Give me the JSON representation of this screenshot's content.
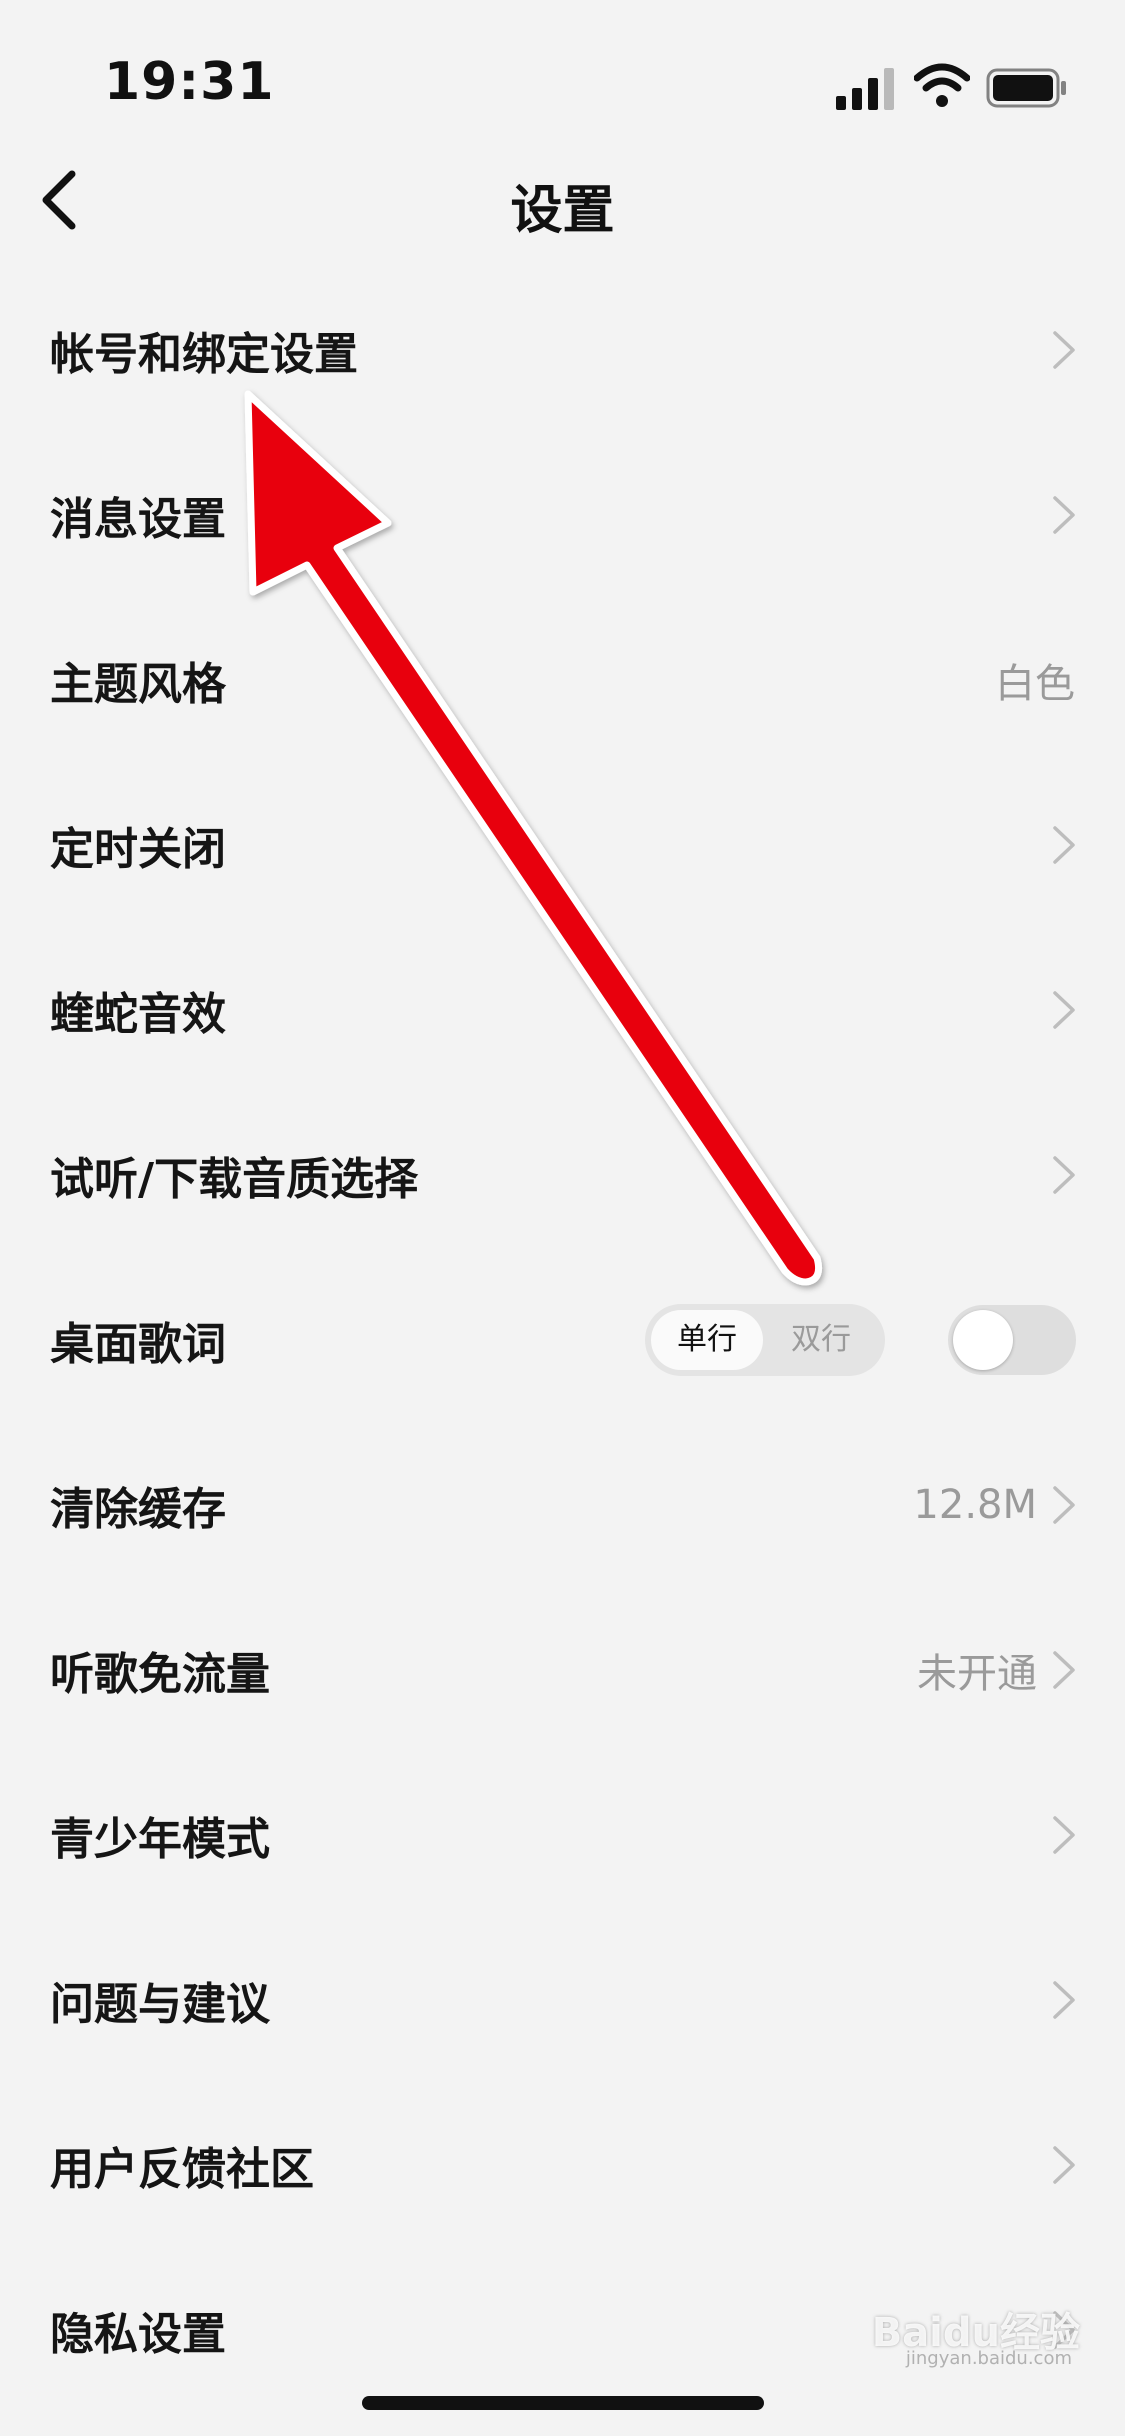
{
  "status_bar": {
    "time": "19:31",
    "icons": [
      "signal-icon",
      "wifi-icon",
      "battery-icon"
    ]
  },
  "nav": {
    "title": "设置",
    "back_icon": "chevron-left-icon"
  },
  "settings": [
    {
      "label": "帐号和绑定设置",
      "value": "",
      "chevron": true
    },
    {
      "label": "消息设置",
      "value": "",
      "chevron": true
    },
    {
      "label": "主题风格",
      "value": "白色",
      "chevron": false
    },
    {
      "label": "定时关闭",
      "value": "",
      "chevron": true
    },
    {
      "label": "蝰蛇音效",
      "value": "",
      "chevron": true
    },
    {
      "label": "试听/下载音质选择",
      "value": "",
      "chevron": true
    },
    {
      "label": "桌面歌词",
      "segments": [
        "单行",
        "双行"
      ],
      "selected_segment": "单行",
      "toggle_on": false
    },
    {
      "label": "清除缓存",
      "value": "12.8M",
      "chevron": true
    },
    {
      "label": "听歌免流量",
      "value": "未开通",
      "chevron": true
    },
    {
      "label": "青少年模式",
      "value": "",
      "chevron": true
    },
    {
      "label": "问题与建议",
      "value": "",
      "chevron": true
    },
    {
      "label": "用户反馈社区",
      "value": "",
      "chevron": true
    },
    {
      "label": "隐私设置",
      "value": "",
      "chevron": true
    }
  ],
  "annotation": {
    "color": "#e8000b",
    "outline": "#ffffff"
  },
  "watermark": {
    "text": "Baidu经验",
    "sub": "jingyan.baidu.com"
  },
  "colors": {
    "background": "#f3f3f3",
    "primary_text": "#151515",
    "secondary_text": "#9a9a9a"
  }
}
